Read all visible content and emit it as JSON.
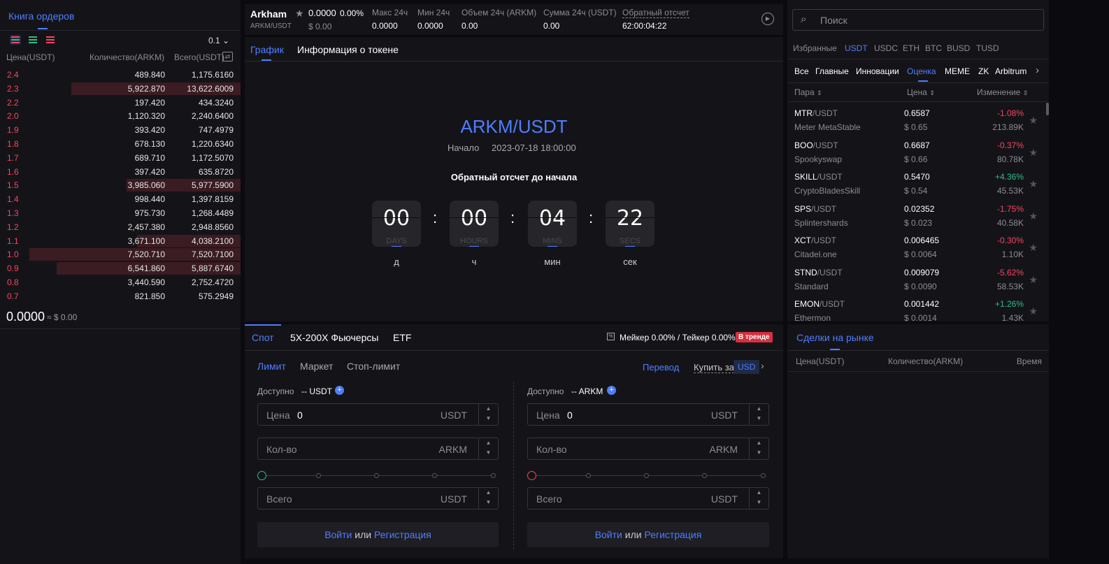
{
  "orderbook": {
    "title": "Книга ордеров",
    "precision": "0.1",
    "col_price": "Цена(USDT)",
    "col_amount": "Количество(ARKM)",
    "col_total": "Всего(USDT)",
    "asks": [
      {
        "price": "2.4",
        "amount": "489.840",
        "total": "1,175.6160",
        "depth": 0.0
      },
      {
        "price": "2.3",
        "amount": "5,922.870",
        "total": "13,622.6009",
        "depth": 0.8
      },
      {
        "price": "2.2",
        "amount": "197.420",
        "total": "434.3240",
        "depth": 0.0
      },
      {
        "price": "2.0",
        "amount": "1,120.320",
        "total": "2,240.6400",
        "depth": 0.0
      },
      {
        "price": "1.9",
        "amount": "393.420",
        "total": "747.4979",
        "depth": 0.0
      },
      {
        "price": "1.8",
        "amount": "678.130",
        "total": "1,220.6340",
        "depth": 0.0
      },
      {
        "price": "1.7",
        "amount": "689.710",
        "total": "1,172.5070",
        "depth": 0.0
      },
      {
        "price": "1.6",
        "amount": "397.420",
        "total": "635.8720",
        "depth": 0.0
      },
      {
        "price": "1.5",
        "amount": "3,985.060",
        "total": "5,977.5900",
        "depth": 0.54
      },
      {
        "price": "1.4",
        "amount": "998.440",
        "total": "1,397.8159",
        "depth": 0.0
      },
      {
        "price": "1.3",
        "amount": "975.730",
        "total": "1,268.4489",
        "depth": 0.0
      },
      {
        "price": "1.2",
        "amount": "2,457.380",
        "total": "2,948.8560",
        "depth": 0.0
      },
      {
        "price": "1.1",
        "amount": "3,671.100",
        "total": "4,038.2100",
        "depth": 0.49
      },
      {
        "price": "1.0",
        "amount": "7,520.710",
        "total": "7,520.7100",
        "depth": 1.0
      },
      {
        "price": "0.9",
        "amount": "6,541.860",
        "total": "5,887.6740",
        "depth": 0.87
      },
      {
        "price": "0.8",
        "amount": "3,440.590",
        "total": "2,752.4720",
        "depth": 0.0
      },
      {
        "price": "0.7",
        "amount": "821.850",
        "total": "575.2949",
        "depth": 0.0
      }
    ],
    "last_price": "0.0000",
    "last_usd": "≈ $ 0.00"
  },
  "header": {
    "name": "Arkham",
    "pair": "ARKM/USDT",
    "price": "0.0000",
    "change": "0.00%",
    "price_usd": "$ 0.00",
    "stats": [
      {
        "label": "Макс 24ч",
        "value": "0.0000"
      },
      {
        "label": "Мин 24ч",
        "value": "0.0000"
      },
      {
        "label": "Объем 24ч (ARKM)",
        "value": "0.00"
      },
      {
        "label": "Сумма 24ч (USDT)",
        "value": "0.00"
      }
    ],
    "countdown_label": "Обратный отсчет",
    "countdown_value": "62:00:04:22"
  },
  "chart_panel": {
    "tab_chart": "График",
    "tab_info": "Информация о токене",
    "pair": "ARKM/USDT",
    "start_label": "Начало",
    "start_value": "2023-07-18 18:00:00",
    "countdown_title": "Обратный отсчет до начала",
    "units": [
      {
        "value": "00",
        "caption": "DAYS",
        "label": "д"
      },
      {
        "value": "00",
        "caption": "HOURS",
        "label": "ч"
      },
      {
        "value": "04",
        "caption": "MINS",
        "label": "мин"
      },
      {
        "value": "22",
        "caption": "SECS",
        "label": "сек"
      }
    ]
  },
  "trade": {
    "tabs": [
      "Спот",
      "5X-200X Фьючерсы",
      "ETF"
    ],
    "fee": "Мейкер 0.00% / Тейкер 0.00%",
    "trend_badge": "В тренде",
    "order_types": [
      "Лимит",
      "Маркет",
      "Стоп-лимит"
    ],
    "transfer": "Перевод",
    "buy_for": "Купить за",
    "buy_currency": "USD",
    "buy": {
      "avail_label": "Доступно",
      "avail_value": "-- USDT",
      "price_label": "Цена",
      "price_value": "0",
      "price_cur": "USDT",
      "qty_label": "Кол-во",
      "qty_cur": "ARKM",
      "total_label": "Всего",
      "total_cur": "USDT"
    },
    "sell": {
      "avail_label": "Доступно",
      "avail_value": "-- ARKM",
      "price_label": "Цена",
      "price_value": "0",
      "price_cur": "USDT",
      "qty_label": "Кол-во",
      "qty_cur": "ARKM",
      "total_label": "Всего",
      "total_cur": "USDT"
    },
    "login": "Войти",
    "or": "или",
    "register": "Регистрация",
    "colors": {
      "buy": "#2ebd85",
      "sell": "#f6465d",
      "accent": "#4f7dff"
    }
  },
  "market": {
    "search_placeholder": "Поиск",
    "quotes": [
      "Избранные",
      "USDT",
      "USDC",
      "ETH",
      "BTC",
      "BUSD",
      "TUSD"
    ],
    "categories": [
      "Все",
      "Главные",
      "Инновации",
      "Оценка",
      "MEME",
      "ZK",
      "Arbitrum"
    ],
    "col_pair": "Пара",
    "col_price": "Цена",
    "col_change": "Изменение",
    "rows": [
      {
        "base": "MTR",
        "quote": "/USDT",
        "name": "Meter MetaStable",
        "price": "0.6587",
        "usd": "$ 0.65",
        "change": "-1.08%",
        "vol": "213.89K",
        "up": false
      },
      {
        "base": "BOO",
        "quote": "/USDT",
        "name": "Spookyswap",
        "price": "0.6687",
        "usd": "$ 0.66",
        "change": "-0.37%",
        "vol": "80.78K",
        "up": false
      },
      {
        "base": "SKILL",
        "quote": "/USDT",
        "name": "CryptoBladesSkill",
        "price": "0.5470",
        "usd": "$ 0.54",
        "change": "+4.36%",
        "vol": "45.53K",
        "up": true
      },
      {
        "base": "SPS",
        "quote": "/USDT",
        "name": "Splintershards",
        "price": "0.02352",
        "usd": "$ 0.023",
        "change": "-1.75%",
        "vol": "40.58K",
        "up": false
      },
      {
        "base": "XCT",
        "quote": "/USDT",
        "name": "Citadel.one",
        "price": "0.006465",
        "usd": "$ 0.0064",
        "change": "-0.30%",
        "vol": "1.10K",
        "up": false
      },
      {
        "base": "STND",
        "quote": "/USDT",
        "name": "Standard",
        "price": "0.009079",
        "usd": "$ 0.0090",
        "change": "-5.62%",
        "vol": "58.53K",
        "up": false
      },
      {
        "base": "EMON",
        "quote": "/USDT",
        "name": "Ethermon",
        "price": "0.001442",
        "usd": "$ 0.0014",
        "change": "+1.26%",
        "vol": "1.43K",
        "up": true
      }
    ]
  },
  "trades": {
    "title": "Сделки на рынке",
    "col_price": "Цена(USDT)",
    "col_amount": "Количество(ARKM)",
    "col_time": "Время"
  }
}
